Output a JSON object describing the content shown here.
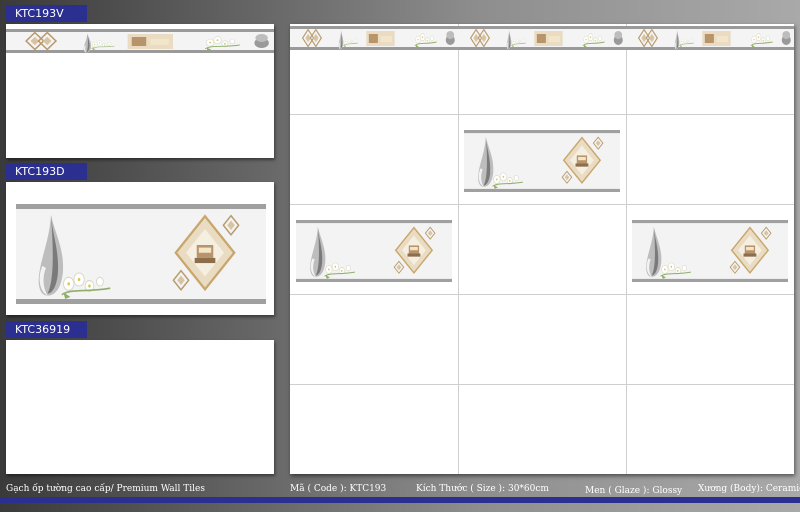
{
  "tiles": {
    "v_label": "KTC193V",
    "d_label": "KTC193D",
    "plain_label": "KTC36919"
  },
  "footer": {
    "description": "Gạch ốp tường cao cấp/ Premium Wall Tiles",
    "code": "Mã ( Code ): KTC193",
    "size": "Kích Thước ( Size ): 30*60cm",
    "glaze": "Men ( Glaze ): Glossy",
    "body": "Xương (Body): Ceramic"
  },
  "colors": {
    "label_bg": "#2b2f8f",
    "accent_gold": "#c9a66b",
    "vase_gray": "#9a9a9a"
  }
}
